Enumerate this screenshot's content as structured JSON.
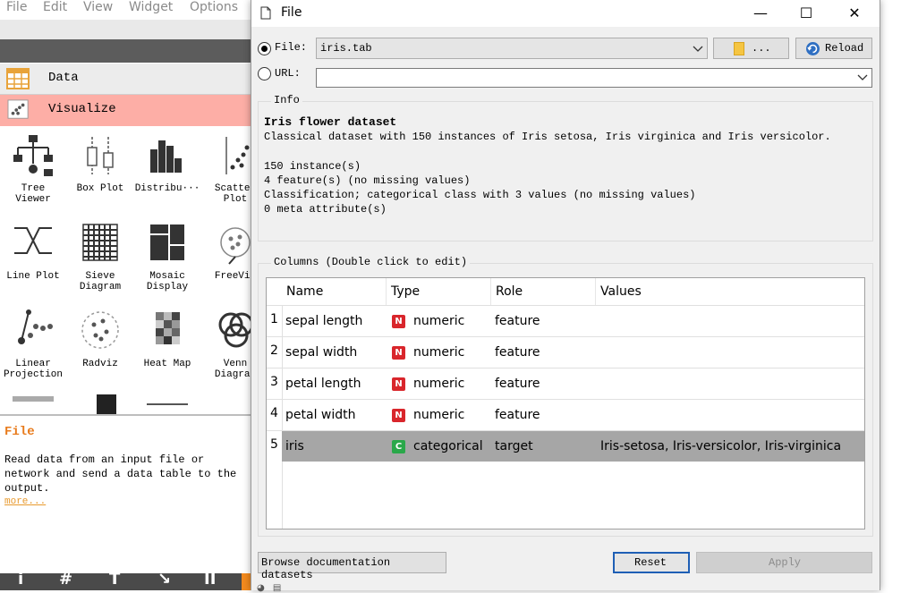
{
  "menubar": [
    "File",
    "Edit",
    "View",
    "Widget",
    "Options"
  ],
  "categories": [
    {
      "label": "Data"
    },
    {
      "label": "Visualize"
    }
  ],
  "widgets": [
    {
      "label": "Tree\nViewer"
    },
    {
      "label": "Box Plot"
    },
    {
      "label": "Distribu···"
    },
    {
      "label": "Scatter\nPlot"
    },
    {
      "label": "Line Plot"
    },
    {
      "label": "Sieve\nDiagram"
    },
    {
      "label": "Mosaic\nDisplay"
    },
    {
      "label": "FreeViz"
    },
    {
      "label": "Linear\nProjection"
    },
    {
      "label": "Radviz"
    },
    {
      "label": "Heat Map"
    },
    {
      "label": "Venn\nDiagram"
    }
  ],
  "help": {
    "title": "File",
    "text": "Read data from an input file or network and send a data table to the output.",
    "more": "more..."
  },
  "bottom_bar": [
    "i",
    "#",
    "T",
    "↘",
    "II"
  ],
  "dialog": {
    "title": "File",
    "window_buttons": {
      "minimize": "—",
      "maximize": "☐",
      "close": "✕"
    },
    "file_label": "File:",
    "file_value": "iris.tab",
    "browse_label": "...",
    "reload_label": "Reload",
    "url_label": "URL:",
    "url_value": "",
    "info_title": "Info",
    "info_heading": "Iris flower dataset",
    "info_lines": "Classical dataset with 150 instances of Iris setosa, Iris virginica and Iris versicolor.\n\n150 instance(s)\n4 feature(s) (no missing values)\nClassification; categorical class with 3 values (no missing values)\n0 meta attribute(s)",
    "columns_title": "Columns (Double click to edit)",
    "table_headers": [
      "Name",
      "Type",
      "Role",
      "Values"
    ],
    "rows": [
      {
        "n": "1",
        "name": "sepal length",
        "badge": "N",
        "type": "numeric",
        "role": "feature",
        "values": ""
      },
      {
        "n": "2",
        "name": "sepal width",
        "badge": "N",
        "type": "numeric",
        "role": "feature",
        "values": ""
      },
      {
        "n": "3",
        "name": "petal length",
        "badge": "N",
        "type": "numeric",
        "role": "feature",
        "values": ""
      },
      {
        "n": "4",
        "name": "petal width",
        "badge": "N",
        "type": "numeric",
        "role": "feature",
        "values": ""
      },
      {
        "n": "5",
        "name": "iris",
        "badge": "C",
        "type": "categorical",
        "role": "target",
        "values": "Iris-setosa, Iris-versicolor, Iris-virginica"
      }
    ],
    "browse_docs_label": "Browse documentation datasets",
    "reset_label": "Reset",
    "apply_label": "Apply"
  },
  "colors": {
    "numeric_badge": "#d9262c",
    "categorical_badge": "#2aa84a",
    "visualize_bg": "#fdaea6",
    "help_title": "#e87b1c",
    "selected_row": "#a6a6a6"
  }
}
